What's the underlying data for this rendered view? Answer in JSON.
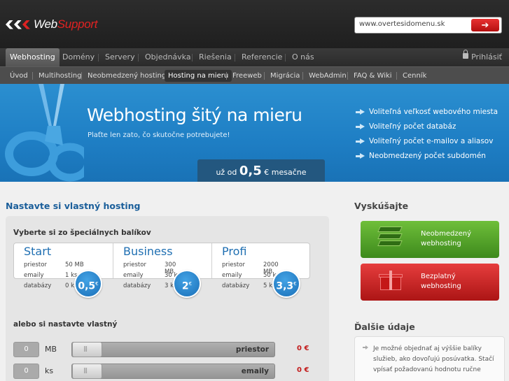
{
  "header": {
    "logo": {
      "web": "Web",
      "support": "Support"
    },
    "domain_search": {
      "value": "www.overtesidomenu.sk",
      "button_icon": "arrow-right-icon"
    }
  },
  "mainnav": {
    "tabs": [
      "Webhosting",
      "Domény",
      "Servery",
      "Objednávka",
      "Riešenia",
      "Referencie",
      "O nás"
    ],
    "login": "Prihlásiť"
  },
  "subnav": {
    "items": [
      "Úvod",
      "Multihosting",
      "Neobmedzený hosting",
      "Hosting na mieru",
      "Freeweb",
      "Migrácia",
      "WebAdmin",
      "FAQ & Wiki",
      "Cenník"
    ]
  },
  "banner": {
    "title": "Webhosting šitý na mieru",
    "subtitle": "Plaťte len zato, čo skutočne potrebujete!",
    "price_prefix": "už od",
    "price_value": "0,5",
    "price_suffix": "€ mesačne",
    "features": [
      "Voliteľná veľkosť webového miesta",
      "Voliteľný počet databáz",
      "Voliteľný počet e-mailov a aliasov",
      "Neobmedzený počet subdomén"
    ]
  },
  "configurator": {
    "title": "Nastavte si vlastný hosting",
    "packages_label": "Vyberte si zo špeciálnych balíkov",
    "packages": [
      {
        "name": "Start",
        "rows": [
          [
            "priestor",
            "50 MB"
          ],
          [
            "emaily",
            "1 ks"
          ],
          [
            "databázy",
            "0 ks"
          ]
        ],
        "price": "0,5",
        "currency": "€"
      },
      {
        "name": "Business",
        "rows": [
          [
            "priestor",
            "300 MB"
          ],
          [
            "emaily",
            "30 ks"
          ],
          [
            "databázy",
            "3 ks"
          ]
        ],
        "price": "2",
        "currency": "€"
      },
      {
        "name": "Profi",
        "rows": [
          [
            "priestor",
            "2000 MB"
          ],
          [
            "emaily",
            "50 ks"
          ],
          [
            "databázy",
            "5 ks"
          ]
        ],
        "price": "3,3",
        "currency": "€"
      }
    ],
    "custom_label": "alebo si nastavte vlastný",
    "sliders": [
      {
        "value": "0",
        "unit": "MB",
        "label": "priestor",
        "price": "0 €"
      },
      {
        "value": "0",
        "unit": "ks",
        "label": "emaily",
        "price": "0 €"
      }
    ]
  },
  "sidebar": {
    "try_title": "Vyskúšajte",
    "cta_unlimited": {
      "line1": "Neobmedzený",
      "line2": "webhosting",
      "icon": "server-stack-icon",
      "color": "#4a9a26"
    },
    "cta_free": {
      "line1": "Bezplatný",
      "line2": "webhosting",
      "icon": "gift-box-icon",
      "color": "#c41818"
    },
    "more_title": "Ďalšie údaje",
    "info": "Je možné objednať aj výššie balíky služieb, ako dovoľujú posúvatka. Stačí vpísať požadovanú hodnotu ručne"
  }
}
